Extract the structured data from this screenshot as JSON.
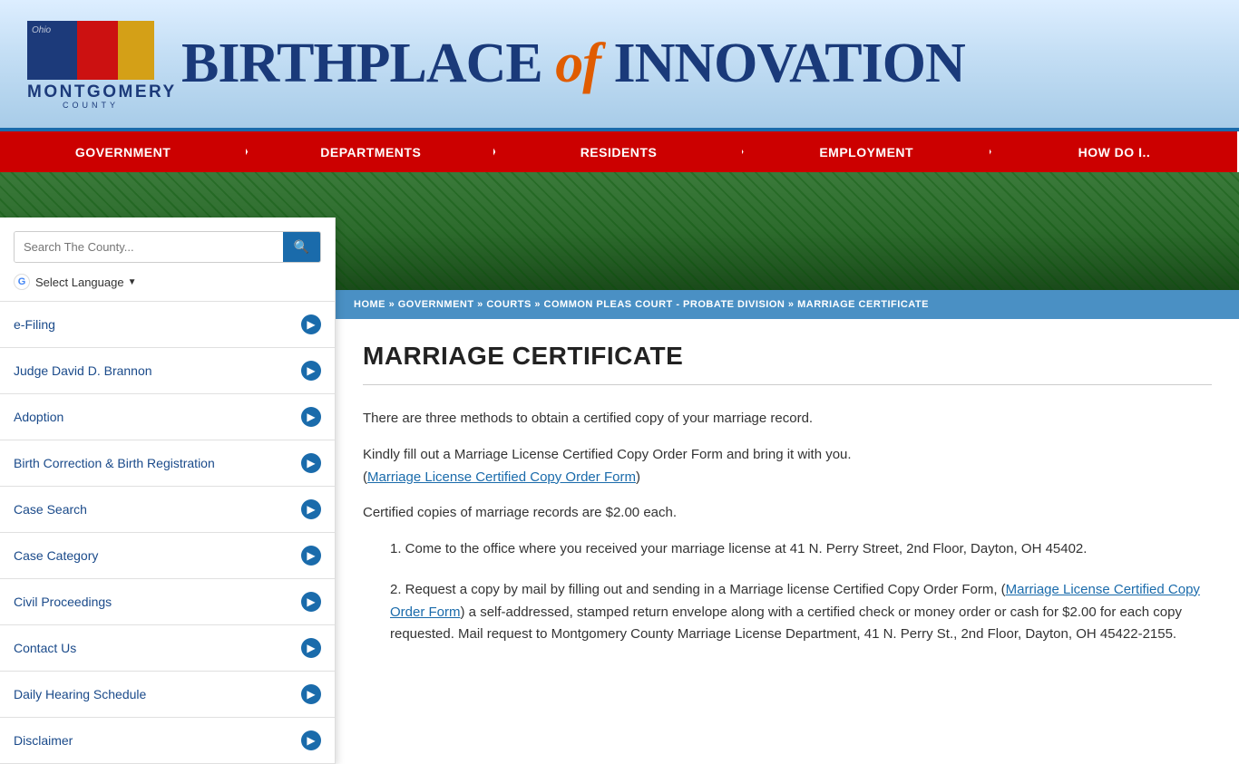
{
  "header": {
    "logo_alt": "Montgomery County Ohio",
    "title_part1": "BIRTHPLACE ",
    "title_italic": "of",
    "title_part2": " INNOVATION",
    "county_name": "MONTGOMERY",
    "county_sub": "COUNTY"
  },
  "nav": {
    "items": [
      {
        "label": "GOVERNMENT",
        "id": "nav-government"
      },
      {
        "label": "DEPARTMENTS",
        "id": "nav-departments"
      },
      {
        "label": "RESIDENTS",
        "id": "nav-residents"
      },
      {
        "label": "EMPLOYMENT",
        "id": "nav-employment"
      },
      {
        "label": "HOW DO I..",
        "id": "nav-howdoi"
      }
    ]
  },
  "sidebar": {
    "search_placeholder": "Search The County...",
    "translate_label": "Select Language",
    "items": [
      {
        "label": "e-Filing",
        "id": "efiling"
      },
      {
        "label": "Judge David D. Brannon",
        "id": "judge"
      },
      {
        "label": "Adoption",
        "id": "adoption"
      },
      {
        "label": "Birth Correction & Birth Registration",
        "id": "birth"
      },
      {
        "label": "Case Search",
        "id": "casesearch"
      },
      {
        "label": "Case Category",
        "id": "casecategory"
      },
      {
        "label": "Civil Proceedings",
        "id": "civil"
      },
      {
        "label": "Contact Us",
        "id": "contact"
      },
      {
        "label": "Daily Hearing Schedule",
        "id": "hearing"
      },
      {
        "label": "Disclaimer",
        "id": "disclaimer"
      }
    ]
  },
  "breadcrumb": {
    "home": "HOME",
    "government": "GOVERNMENT",
    "courts": "COURTS",
    "court_name": "COMMON PLEAS COURT - PROBATE DIVISION",
    "current": "MARRIAGE CERTIFICATE"
  },
  "content": {
    "page_title": "MARRIAGE CERTIFICATE",
    "intro1": "There are three methods to obtain a certified copy of your marriage record.",
    "intro2": "Kindly fill out a Marriage License Certified Copy Order Form and bring it with you.",
    "form_link_text": "Marriage License Certified Copy Order Form",
    "intro2_suffix": ")",
    "intro3": "Certified copies of marriage records are $2.00 each.",
    "method1": "1. Come to the office where you received your marriage license at 41 N. Perry Street, 2nd Floor, Dayton, OH 45402.",
    "method2_prefix": "2. Request a copy by mail by filling out and sending in a Marriage license Certified Copy Order Form, (",
    "method2_link": "Marriage License Certified Copy Order Form",
    "method2_suffix": ") a self-addressed, stamped return envelope along with a certified check or money order or cash for $2.00 for each copy requested. Mail request to Montgomery County Marriage License Department, 41 N. Perry St., 2nd Floor, Dayton, OH 45422-2155."
  }
}
